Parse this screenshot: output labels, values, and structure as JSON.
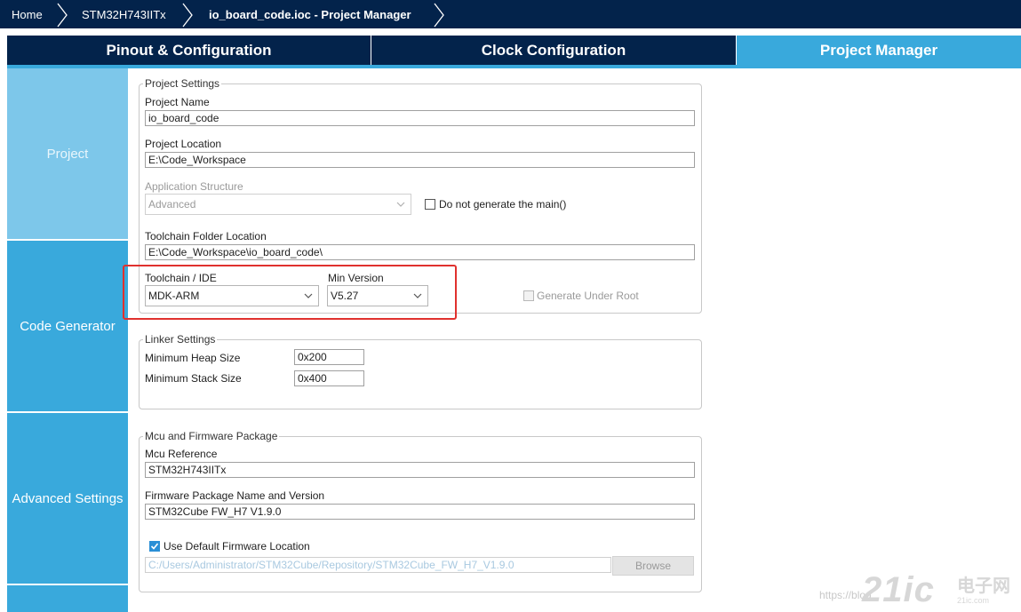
{
  "breadcrumb": {
    "home": "Home",
    "device": "STM32H743IITx",
    "current": "io_board_code.ioc - Project Manager"
  },
  "tabs": {
    "pinout": "Pinout & Configuration",
    "clock": "Clock Configuration",
    "project_manager": "Project Manager",
    "active": "Project Manager"
  },
  "sidebar": {
    "items": [
      {
        "label": "Project",
        "selected": true
      },
      {
        "label": "Code Generator",
        "selected": false
      },
      {
        "label": "Advanced Settings",
        "selected": false
      }
    ]
  },
  "project_settings": {
    "legend": "Project Settings",
    "project_name_label": "Project Name",
    "project_name_value": "io_board_code",
    "project_location_label": "Project Location",
    "project_location_value": "E:\\Code_Workspace",
    "app_structure_label": "Application Structure",
    "app_structure_value": "Advanced",
    "no_main_label": "Do not generate the main()",
    "no_main_checked": false,
    "toolchain_folder_label": "Toolchain Folder Location",
    "toolchain_folder_value": "E:\\Code_Workspace\\io_board_code\\",
    "toolchain_label": "Toolchain / IDE",
    "toolchain_value": "MDK-ARM",
    "min_version_label": "Min Version",
    "min_version_value": "V5.27",
    "gen_under_root_label": "Generate Under Root",
    "gen_under_root_checked": false
  },
  "linker_settings": {
    "legend": "Linker Settings",
    "heap_label": "Minimum Heap Size",
    "heap_value": "0x200",
    "stack_label": "Minimum Stack Size",
    "stack_value": "0x400"
  },
  "firmware": {
    "legend": "Mcu and Firmware Package",
    "mcu_ref_label": "Mcu Reference",
    "mcu_ref_value": "STM32H743IITx",
    "fw_name_label": "Firmware Package Name and Version",
    "fw_name_value": "STM32Cube FW_H7 V1.9.0",
    "use_default_label": "Use Default Firmware Location",
    "use_default_checked": true,
    "fw_path_value": "C:/Users/Administrator/STM32Cube/Repository/STM32Cube_FW_H7_V1.9.0",
    "browse_label": "Browse"
  },
  "watermark": {
    "url": "https://blog",
    "logo": "21ic",
    "cn": "电子网",
    "domain": "21ic.com"
  },
  "colors": {
    "navy": "#03234b",
    "accent": "#39a9dc",
    "highlight_red": "#e0312e"
  }
}
